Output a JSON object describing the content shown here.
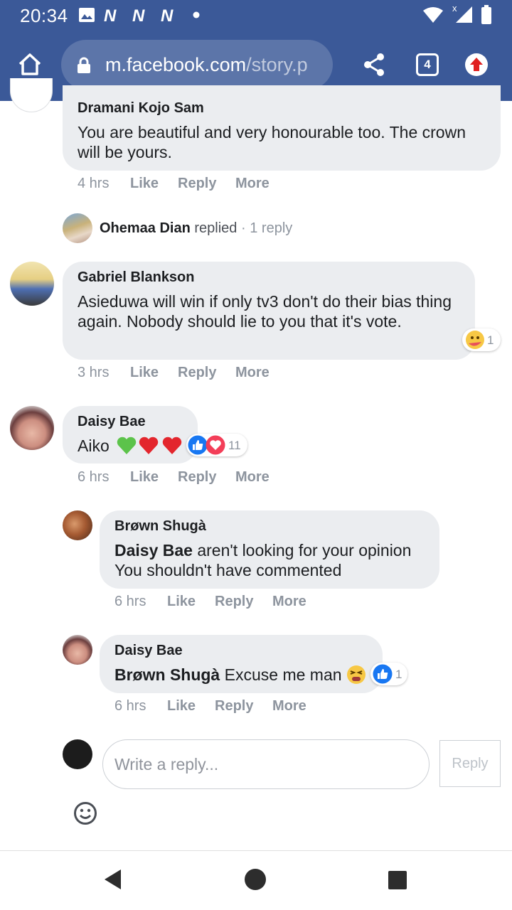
{
  "status_bar": {
    "time": "20:34",
    "icons": [
      "image-icon",
      "n-notification-icon",
      "n-notification-icon",
      "n-notification-icon",
      "dot-icon",
      "wifi-icon",
      "signal-icon",
      "battery-icon"
    ]
  },
  "browser": {
    "url_domain": "m.facebook.com",
    "url_path": "/story.p",
    "tab_count": "4",
    "icons": [
      "home-icon",
      "lock-icon",
      "share-icon",
      "tab-count-icon",
      "update-arrow-icon"
    ],
    "brand_color": "#3b5998"
  },
  "comments": [
    {
      "author": "Dramani Kojo Sam",
      "text": "You are beautiful and very honourable too. The crown will be yours.",
      "time": "4 hrs",
      "like": "Like",
      "reply": "Reply",
      "more": "More"
    },
    {
      "replied_by": "Ohemaa Dian",
      "replied_word": "replied",
      "separator": "·",
      "reply_count": "1 reply"
    },
    {
      "author": "Gabriel Blankson",
      "text": "Asieduwa will win if only tv3 don't do their bias thing again. Nobody should lie to you that it's vote.",
      "time": "3 hrs",
      "like": "Like",
      "reply": "Reply",
      "more": "More",
      "reaction_count": "1",
      "reactions": [
        "care-reaction-icon"
      ]
    },
    {
      "author": "Daisy Bae",
      "text": "Aiko",
      "emojis": [
        "green-heart-icon",
        "red-heart-icon",
        "red-heart-icon"
      ],
      "time": "6 hrs",
      "like": "Like",
      "reply": "Reply",
      "more": "More",
      "reaction_count": "11",
      "reactions": [
        "like-reaction-icon",
        "love-reaction-icon"
      ]
    }
  ],
  "replies": [
    {
      "author": "Brøwn Shugà",
      "mention": "Daisy Bae",
      "text_line1": "aren't looking for your opinion",
      "text_line2": "You shouldn't have commented",
      "time": "6 hrs",
      "like": "Like",
      "reply": "Reply",
      "more": "More"
    },
    {
      "author": "Daisy Bae",
      "mention": "Brøwn Shugà",
      "text": "Excuse me man",
      "emojis": [
        "tired-face-icon"
      ],
      "time": "6 hrs",
      "like": "Like",
      "reply": "Reply",
      "more": "More",
      "reaction_count": "1",
      "reactions": [
        "like-reaction-icon"
      ]
    }
  ],
  "reply_box": {
    "placeholder": "Write a reply...",
    "button": "Reply",
    "icons": [
      "emoji-icon"
    ]
  },
  "nav_bar": {
    "icons": [
      "back-icon",
      "home-circle-icon",
      "recents-icon"
    ]
  }
}
